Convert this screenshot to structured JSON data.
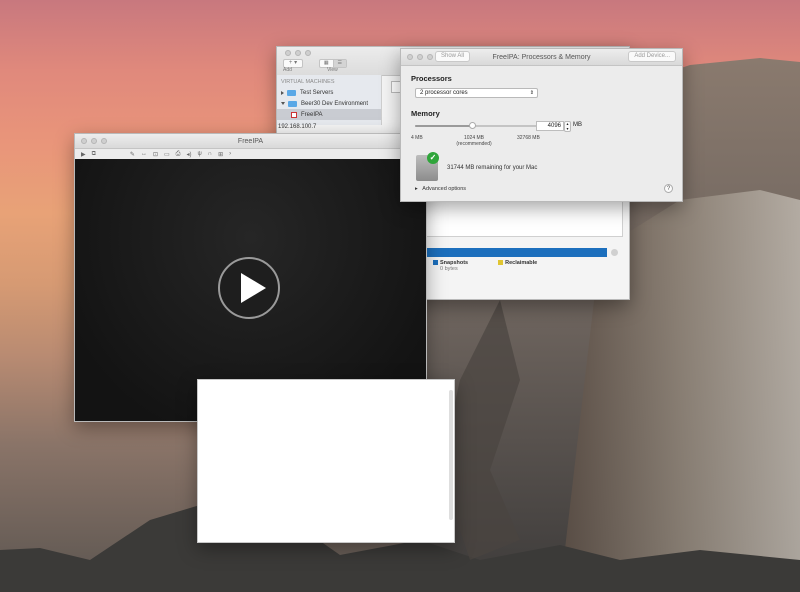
{
  "library_window": {
    "toolbar": {
      "add_label": "Add",
      "view_label": "View"
    },
    "sidebar": {
      "section_header": "VIRTUAL MACHINES",
      "items": [
        {
          "label": "Test Servers"
        },
        {
          "label": "Beer30 Dev Environment"
        },
        {
          "label": "FreeIPA"
        }
      ]
    },
    "ip_address": "192.168.100.7",
    "legend": [
      {
        "label": "Snapshots",
        "sub": "0 bytes",
        "color": "#1c6fbd"
      },
      {
        "label": "Reclaimable",
        "color": "#e0c531"
      }
    ]
  },
  "vm_window": {
    "title": "FreeIPA",
    "colors": {
      "screen": "#131313"
    }
  },
  "processors_window": {
    "title": "FreeIPA: Processors & Memory",
    "show_all_label": "Show All",
    "add_device_label": "Add Device...",
    "processors_heading": "Processors",
    "processor_select_value": "2 processor cores",
    "memory_heading": "Memory",
    "memory_value": "4096",
    "memory_unit": "MB",
    "memory_slider_fraction": 0.46,
    "memory_ticks": {
      "min": "4 MB",
      "recommended": "1024 MB",
      "recommended_note": "(recommended)",
      "max": "32768 MB"
    },
    "remaining_text": "31744 MB remaining for your Mac",
    "advanced_label": "Advanced options",
    "help_label": "?"
  }
}
